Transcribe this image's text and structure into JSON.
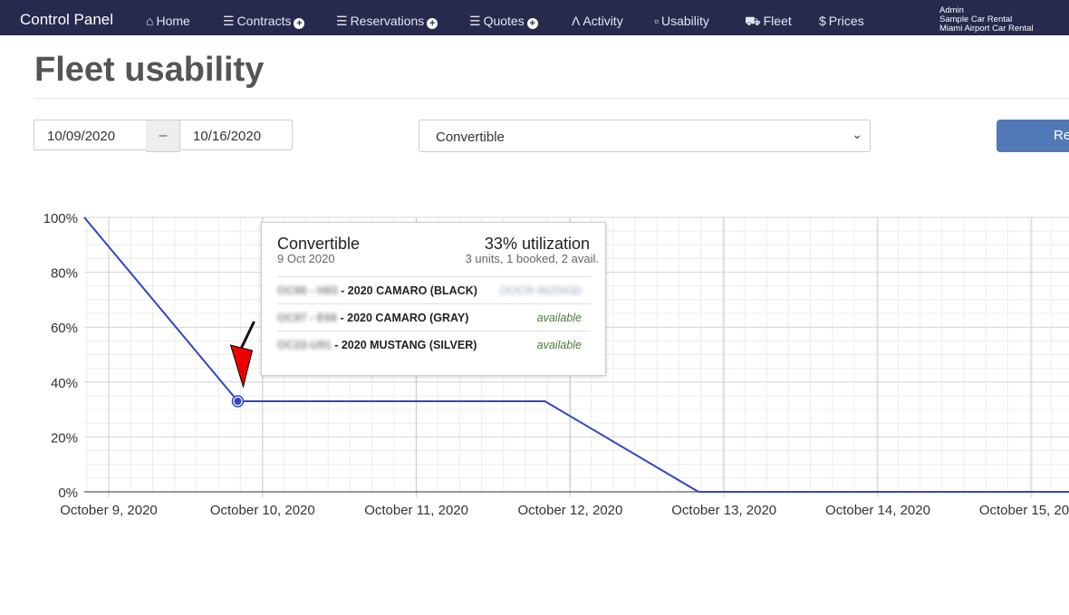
{
  "nav": {
    "brand": "Control Panel",
    "items": [
      {
        "label": "Home",
        "icon": "home-icon",
        "plus": false
      },
      {
        "label": "Contracts",
        "icon": "list-icon",
        "plus": true
      },
      {
        "label": "Reservations",
        "icon": "list-icon",
        "plus": true
      },
      {
        "label": "Quotes",
        "icon": "list-icon",
        "plus": true
      },
      {
        "label": "Activity",
        "icon": "activity-icon",
        "plus": false
      },
      {
        "label": "Usability",
        "icon": "bar-chart-icon",
        "plus": false
      },
      {
        "label": "Fleet",
        "icon": "car-icon",
        "plus": false
      },
      {
        "label": "Prices",
        "icon": "dollar-icon",
        "plus": false
      }
    ],
    "account": {
      "user": "Admin",
      "company": "Sample Car Rental",
      "location": "Miami Airport Car Rental"
    }
  },
  "page": {
    "title": "Fleet usability"
  },
  "filters": {
    "date_from": "10/09/2020",
    "date_sep": "–",
    "date_to": "10/16/2020",
    "category": "Convertible",
    "submit_label": "Re"
  },
  "chart_data": {
    "type": "line",
    "ylim": [
      0,
      100
    ],
    "yticks": [
      "0%",
      "20%",
      "40%",
      "60%",
      "80%",
      "100%"
    ],
    "xticks": [
      "October 9, 2020",
      "October 10, 2020",
      "October 11, 2020",
      "October 12, 2020",
      "October 13, 2020",
      "October 14, 2020",
      "October 15, 2020"
    ],
    "points": [
      {
        "x": "2020-10-08",
        "y": 100
      },
      {
        "x": "2020-10-09",
        "y": 33
      },
      {
        "x": "2020-10-11",
        "y": 33
      },
      {
        "x": "2020-10-12",
        "y": 0
      },
      {
        "x": "2020-10-15",
        "y": 0
      }
    ],
    "line_color": "#3346c0",
    "grid": true,
    "highlighted": "2020-10-09"
  },
  "tooltip": {
    "title": "Convertible",
    "date": "9 Oct 2020",
    "utilization": "33% utilization",
    "summary": "3 units, 1 booked, 2 avail.",
    "rows": [
      {
        "code": "OC96 - H93",
        "name": " - 2020 CAMARO (BLACK)",
        "status": "OOCR-9620430",
        "booked": true
      },
      {
        "code": "OC97 - E68",
        "name": " - 2020 CAMARO (GRAY)",
        "status": "available",
        "booked": false
      },
      {
        "code": "OC22-U91",
        "name": " - 2020 MUSTANG (SILVER)",
        "status": "available",
        "booked": false
      }
    ]
  }
}
